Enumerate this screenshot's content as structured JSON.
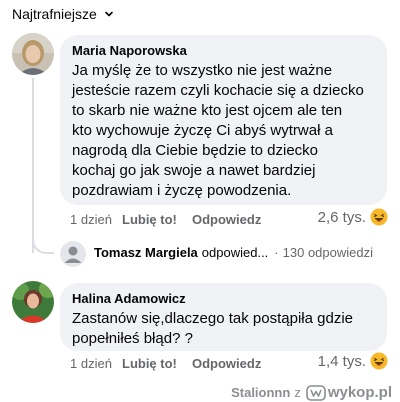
{
  "sort": {
    "label": "Najtrafniejsze"
  },
  "comments": [
    {
      "author": "Maria Naporowska",
      "text": "Ja myślę że to wszystko nie jest ważne\njesteście razem czyli kochacie się a dziecko\nto skarb nie ważne kto jest ojcem ale ten\nkto wychowuje życzę Ci abyś wytrwał a\nnagrodą dla Ciebie będzie to dziecko\nkochaj go jak swoje a nawet bardziej\npozdrawiam i życzę powodzenia.",
      "time": "1 dzień",
      "like_label": "Lubię to!",
      "reply_label": "Odpowiedz",
      "reaction_count": "2,6 tys.",
      "reaction_icon": "laughing-emoji-icon"
    },
    {
      "author": "Halina Adamowicz",
      "text": "Zastanów się,dlaczego tak postąpiła gdzie\npopełniłeś błąd? ?",
      "time": "1 dzień",
      "like_label": "Lubię to!",
      "reply_label": "Odpowiedz",
      "reaction_count": "1,4 tys.",
      "reaction_icon": "laughing-emoji-icon"
    }
  ],
  "reply_summary": {
    "name": "Tomasz Margiela",
    "verb": "odpowied...",
    "separator": "·",
    "count": "130 odpowiedzi"
  },
  "watermark": {
    "user": "Stalionnn",
    "suffix": "z",
    "site": "wykop.pl"
  },
  "colors": {
    "bubble": "#f0f2f5",
    "muted": "#65676b",
    "emoji": "#f7b928"
  }
}
